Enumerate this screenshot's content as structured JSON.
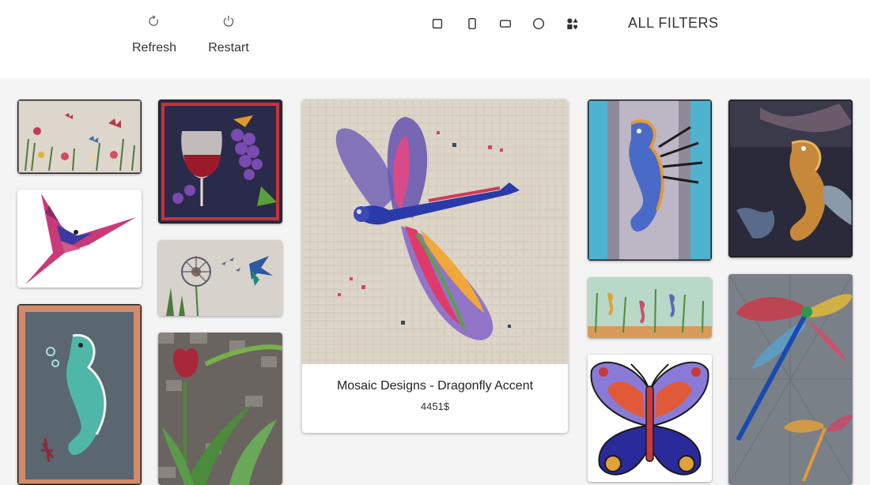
{
  "toolbar": {
    "refresh_label": "Refresh",
    "restart_label": "Restart",
    "all_filters_label": "ALL FILTERS"
  },
  "shape_filters": [
    {
      "icon": "square-icon"
    },
    {
      "icon": "portrait-rectangle-icon"
    },
    {
      "icon": "landscape-rectangle-icon"
    },
    {
      "icon": "circle-icon"
    },
    {
      "icon": "custom-shapes-icon"
    }
  ],
  "featured": {
    "title": "Mosaic Designs - Dragonfly Accent",
    "price": "4451$"
  },
  "colors": {
    "toolbar_bg": "#ffffff",
    "page_bg": "#f4f4f4",
    "text": "#333333"
  }
}
